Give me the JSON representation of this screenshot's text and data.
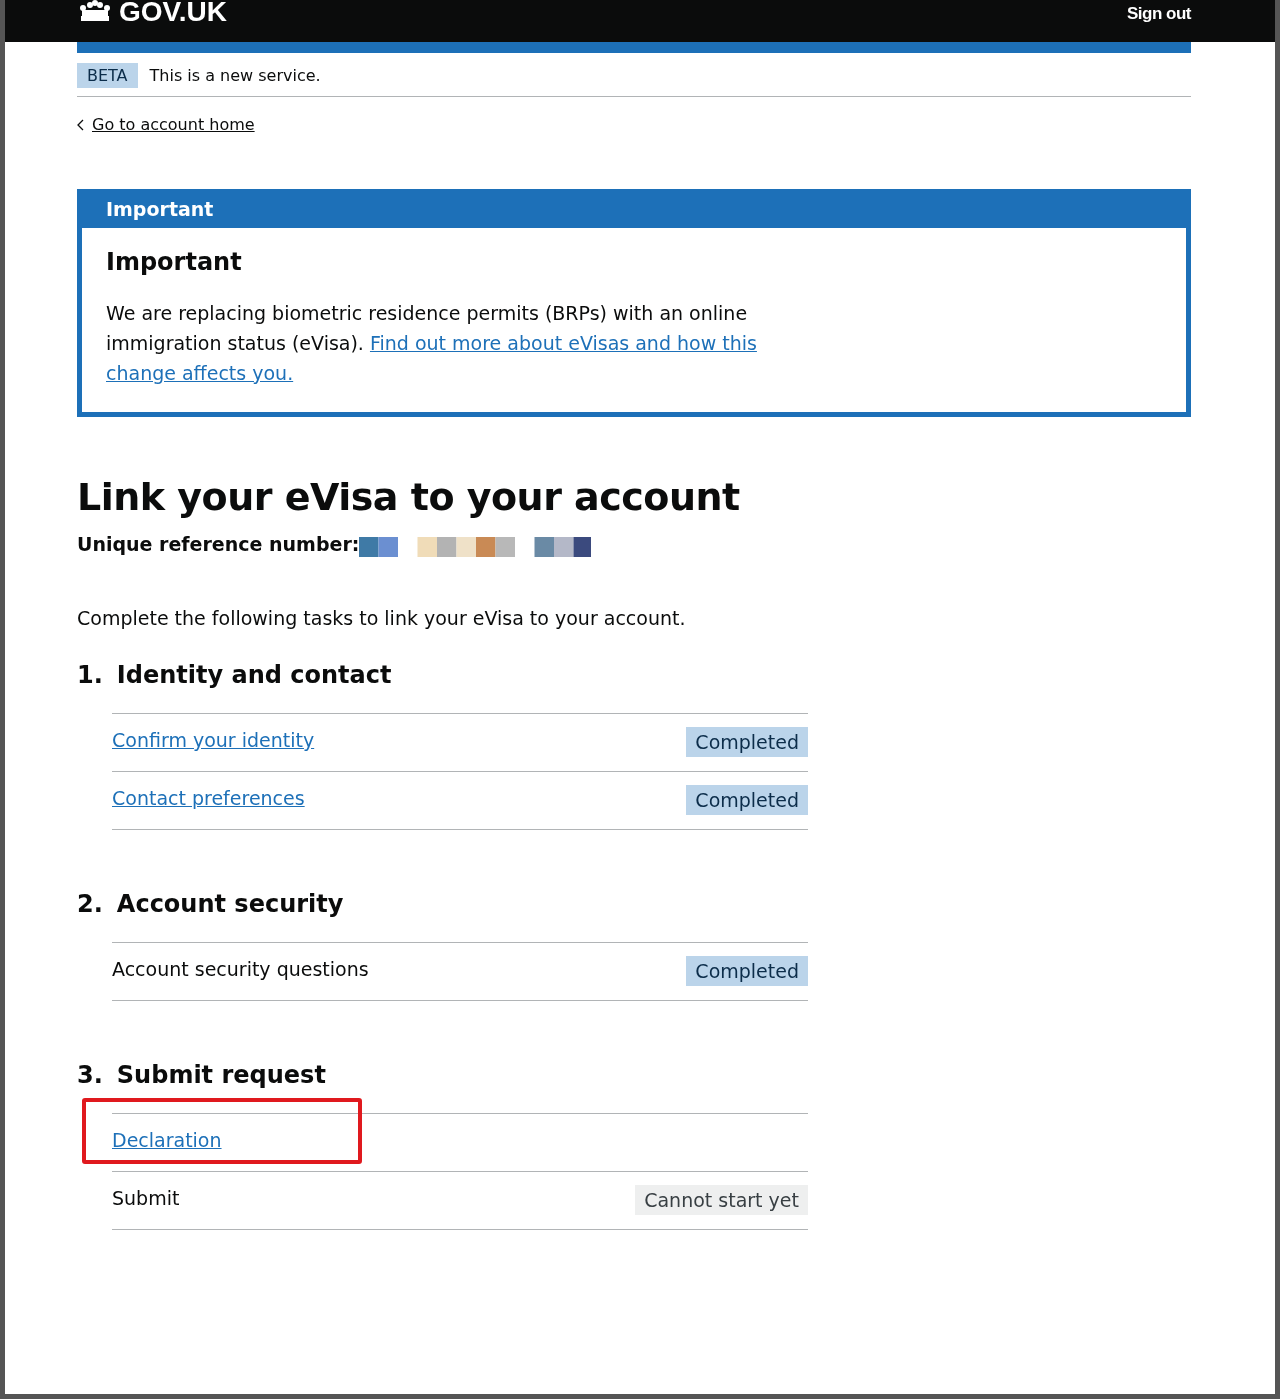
{
  "header": {
    "logo": "GOV.UK",
    "sign_out": "Sign out"
  },
  "phase_banner": {
    "tag": "BETA",
    "text": "This is a new service."
  },
  "back_link": "Go to account home",
  "notification": {
    "banner_title": "Important",
    "heading": "Important",
    "text": "We are replacing biometric residence permits (BRPs) with an online immigration status (eVisa). ",
    "link_lines": [
      "Find out more about eVisas and how this",
      "change affects you."
    ]
  },
  "title": "Link your eVisa to your account",
  "reference_label": "Unique reference number:",
  "intro": "Complete the following tasks to link your eVisa to your account.",
  "sections": [
    {
      "number": "1.",
      "heading": "Identity and contact",
      "tasks": [
        {
          "name": "Confirm your identity",
          "link": true,
          "highlighted": false,
          "status": {
            "text": "Completed",
            "kind": "completed"
          }
        },
        {
          "name": "Contact preferences",
          "link": true,
          "highlighted": false,
          "status": {
            "text": "Completed",
            "kind": "completed"
          }
        }
      ]
    },
    {
      "number": "2.",
      "heading": "Account security",
      "tasks": [
        {
          "name": "Account security questions",
          "link": false,
          "highlighted": false,
          "status": {
            "text": "Completed",
            "kind": "completed"
          }
        }
      ]
    },
    {
      "number": "3.",
      "heading": "Submit request",
      "tasks": [
        {
          "name": "Declaration",
          "link": true,
          "highlighted": true
        },
        {
          "name": "Submit",
          "link": false,
          "highlighted": false,
          "status": {
            "text": "Cannot start yet",
            "kind": "cannot_start"
          }
        }
      ]
    }
  ]
}
